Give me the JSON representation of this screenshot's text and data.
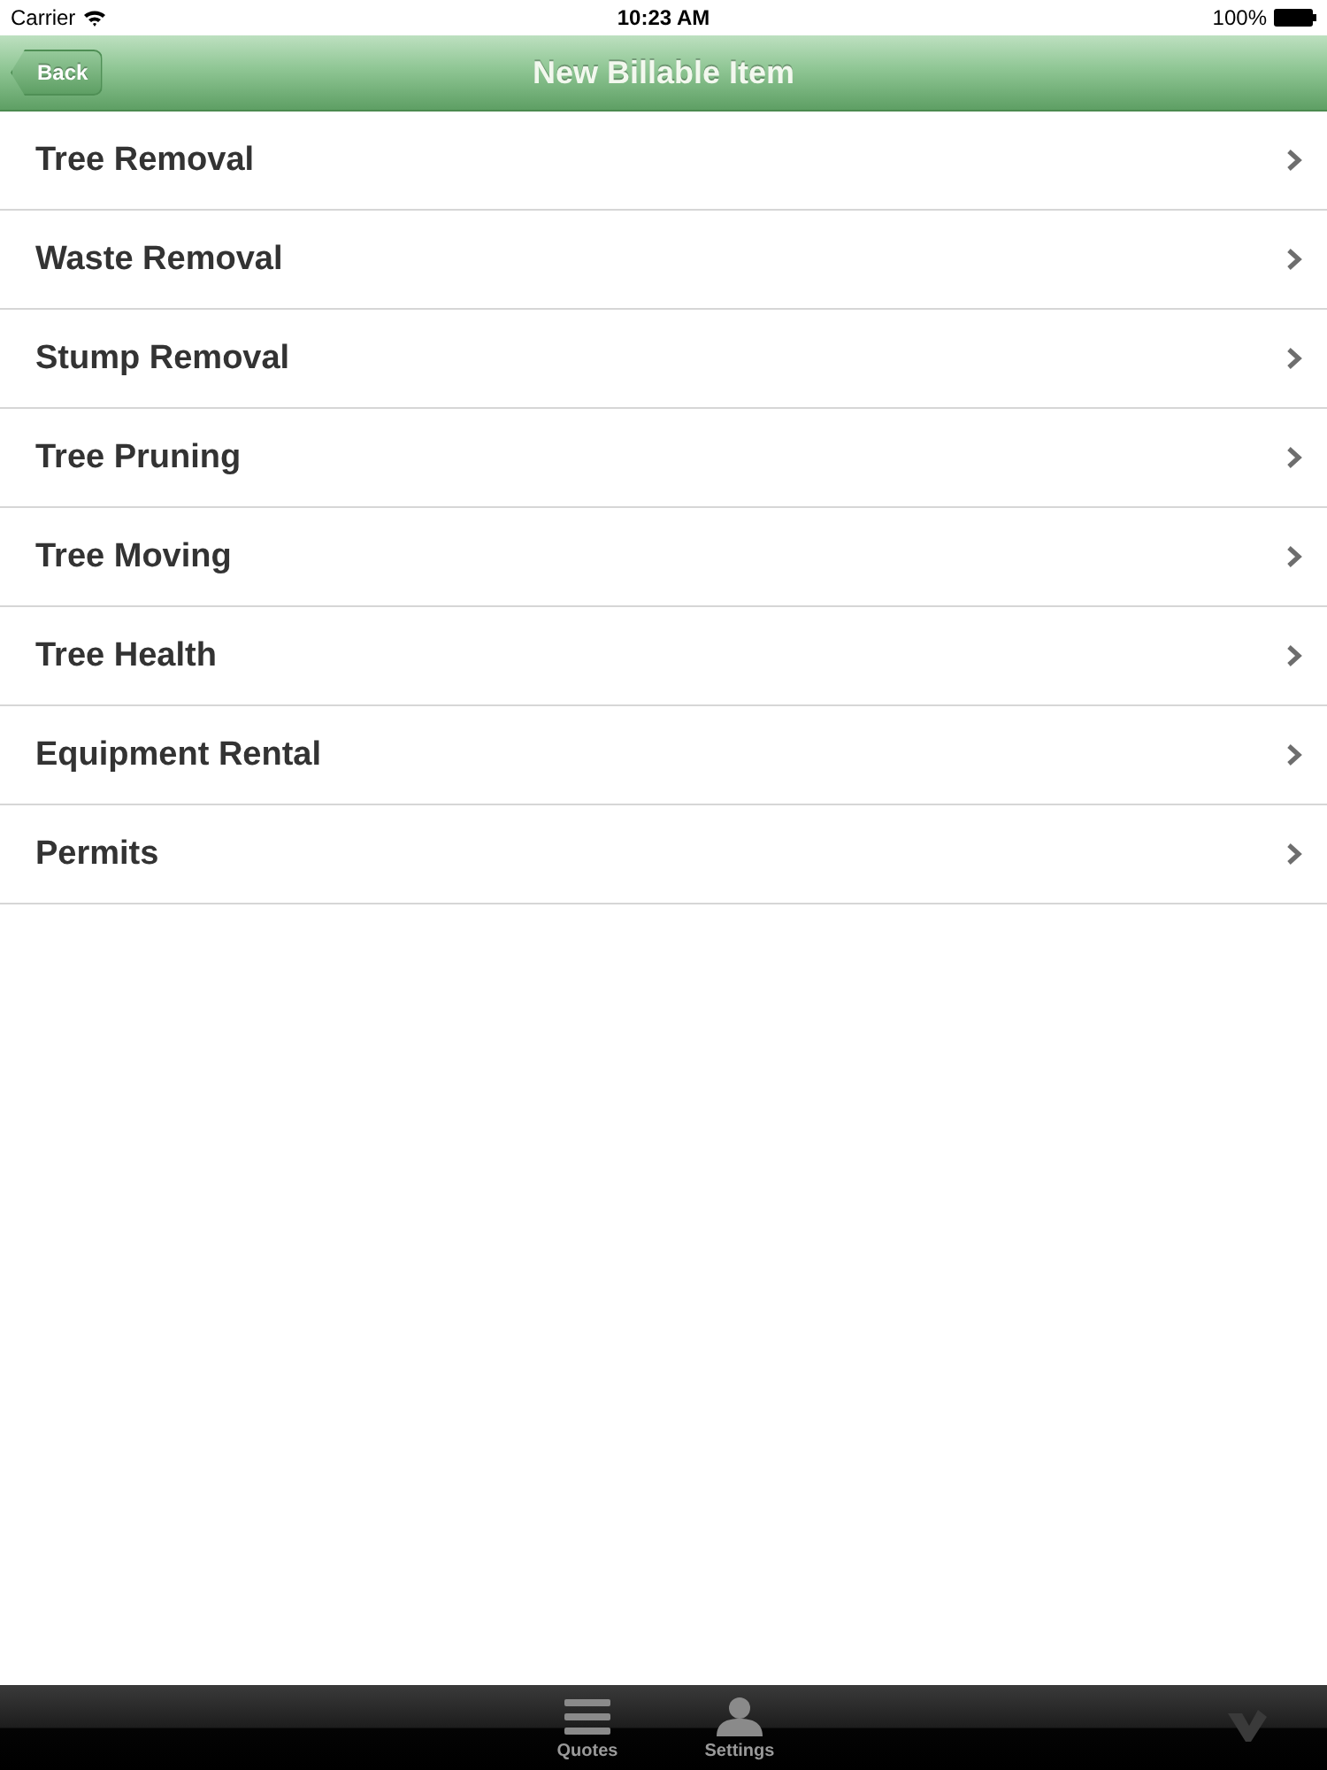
{
  "status_bar": {
    "carrier": "Carrier",
    "time": "10:23 AM",
    "battery": "100%"
  },
  "nav_bar": {
    "back": "Back",
    "title": "New Billable Item"
  },
  "items": [
    {
      "label": "Tree Removal"
    },
    {
      "label": "Waste Removal"
    },
    {
      "label": "Stump Removal"
    },
    {
      "label": "Tree Pruning"
    },
    {
      "label": "Tree Moving"
    },
    {
      "label": "Tree Health"
    },
    {
      "label": "Equipment Rental"
    },
    {
      "label": "Permits"
    }
  ],
  "tab_bar": {
    "tabs": [
      {
        "kind": "list",
        "label": "Quotes"
      },
      {
        "kind": "person",
        "label": "Settings"
      }
    ]
  }
}
